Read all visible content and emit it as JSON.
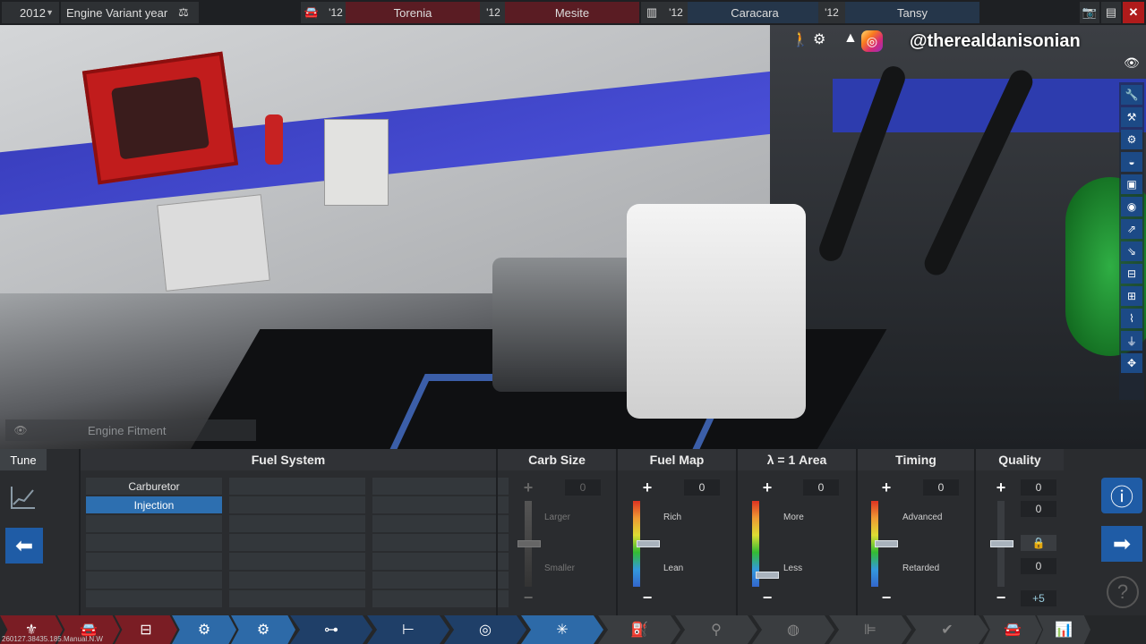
{
  "topbar": {
    "year": "2012",
    "variant_label": "Engine Variant year",
    "families": [
      {
        "year": "'12",
        "name": "Torenia"
      },
      {
        "year": "'12",
        "name": "Mesite"
      },
      {
        "year": "'12",
        "name": "Caracara"
      },
      {
        "year": "'12",
        "name": "Tansy"
      }
    ]
  },
  "overlay": {
    "handle": "@therealdanisonian",
    "fitment_label": "Engine Fitment"
  },
  "panel": {
    "tune_tab": "Tune",
    "headers": {
      "fuel_system": "Fuel System",
      "carb_size": "Carb Size",
      "fuel_map": "Fuel Map",
      "lambda": "λ = 1 Area",
      "timing": "Timing",
      "quality": "Quality"
    },
    "fuel_system_options": [
      "Carburetor",
      "Injection"
    ],
    "selected_fuel_system": "Injection",
    "carb_size": {
      "value": "0",
      "top_label": "Larger",
      "bottom_label": "Smaller",
      "level": 0.5
    },
    "fuel_map": {
      "value": "0",
      "top_label": "Rich",
      "bottom_label": "Lean",
      "level": 0.5
    },
    "lambda": {
      "value": "0",
      "top_label": "More",
      "bottom_label": "Less",
      "level": 0.1
    },
    "timing": {
      "value": "0",
      "top_label": "Advanced",
      "bottom_label": "Retarded",
      "level": 0.5
    },
    "quality": {
      "value_top": "0",
      "value_mid": "0",
      "value_bottom": "0",
      "bonus": "+5",
      "level": 0.5
    }
  },
  "footer": {
    "build": "260127.38435.185.Manual.N.W"
  },
  "colors": {
    "accent_blue": "#1f5ca6",
    "selected_row": "#2d6fb0",
    "family_red": "#5a1c23",
    "family_blue": "#25364a"
  }
}
